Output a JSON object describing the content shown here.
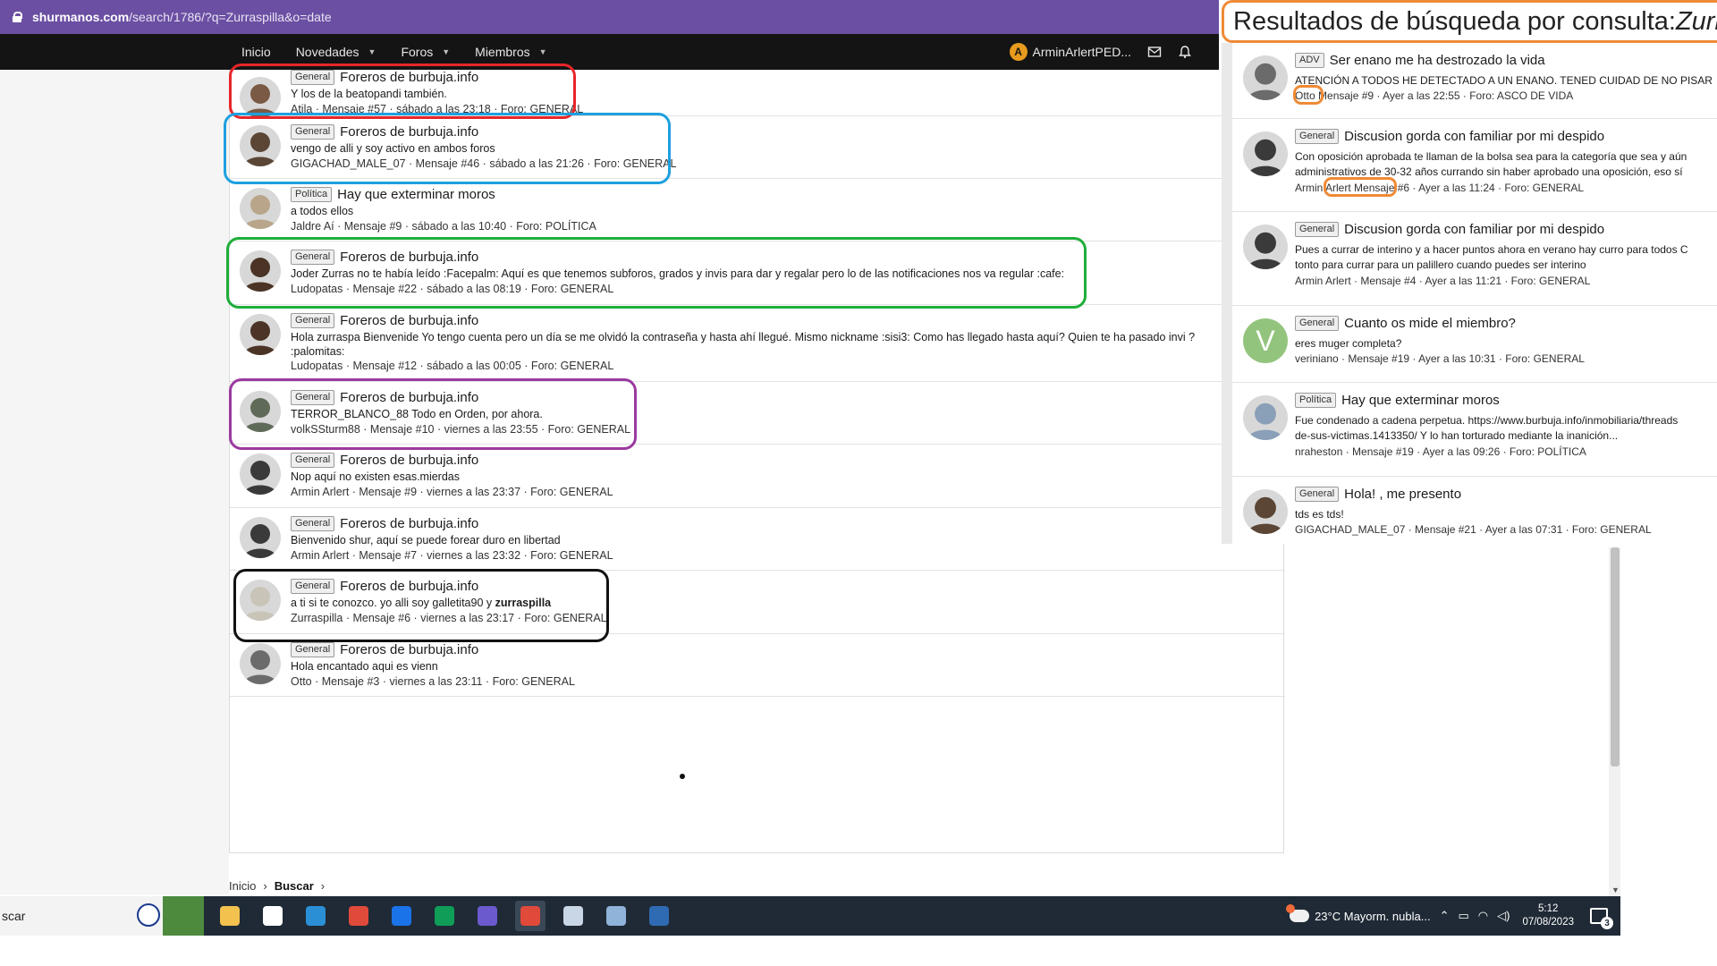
{
  "browser": {
    "url_host": "shurmanos.com",
    "url_path": "/search/1786/?q=Zurraspilla&o=date"
  },
  "nav": {
    "items": [
      {
        "label": "Inicio",
        "has_caret": false
      },
      {
        "label": "Novedades",
        "has_caret": true
      },
      {
        "label": "Foros",
        "has_caret": true
      },
      {
        "label": "Miembros",
        "has_caret": true
      }
    ],
    "user_initial": "A",
    "user_name": "ArminArlertPED..."
  },
  "results": [
    {
      "badge": "General",
      "title": "Foreros de burbuja.info",
      "snippet": "Y los de la beatopandi también.",
      "meta": "Atila · Mensaje #57 · sábado a las 23:18 · Foro: GENERAL",
      "avatar_color": "#7a5a44",
      "highlight": "#e8262a"
    },
    {
      "badge": "General",
      "title": "Foreros de burbuja.info",
      "snippet": "vengo de alli y soy activo en ambos foros",
      "meta": "GIGACHAD_MALE_07 · Mensaje #46 · sábado a las 21:26 · Foro: GENERAL",
      "avatar_color": "#5b4636",
      "highlight": "#1ea0e0"
    },
    {
      "badge": "Política",
      "title": "Hay que exterminar moros",
      "snippet": "a todos ellos",
      "meta": "Jaldre Aí · Mensaje #9 · sábado a las 10:40 · Foro: POLÍTICA",
      "avatar_color": "#b9a68a",
      "highlight": ""
    },
    {
      "badge": "General",
      "title": "Foreros de burbuja.info",
      "snippet": "Joder Zurras no te había leído :Facepalm: Aquí es que tenemos subforos, grados y invis para dar y regalar pero lo de las notificaciones nos va regular :cafe:",
      "meta": "Ludopatas · Mensaje #22 · sábado a las 08:19 · Foro: GENERAL",
      "avatar_color": "#4b3425",
      "highlight": "#1fae3a"
    },
    {
      "badge": "General",
      "title": "Foreros de burbuja.info",
      "snippet": "Hola zurraspa Bienvenide Yo tengo cuenta pero un día se me olvidó la contraseña y hasta ahí llegué. Mismo nickname :sisi3: Como has llegado hasta aquí? Quien te ha pasado invi ?",
      "snippet2": ":palomitas:",
      "meta": "Ludopatas · Mensaje #12 · sábado a las 00:05 · Foro: GENERAL",
      "avatar_color": "#4b3425",
      "highlight": ""
    },
    {
      "badge": "General",
      "title": "Foreros de burbuja.info",
      "snippet": "TERROR_BLANCO_88 Todo en Orden, por ahora.",
      "meta": "volkSSturm88 · Mensaje #10 · viernes a las 23:55 · Foro: GENERAL",
      "avatar_color": "#5f6a58",
      "highlight": "#9b3aa0"
    },
    {
      "badge": "General",
      "title": "Foreros de burbuja.info",
      "snippet": "Nop aquí no existen esas.mierdas",
      "meta": "Armin Arlert · Mensaje #9 · viernes a las 23:37 · Foro: GENERAL",
      "avatar_color": "#3a3a3a",
      "highlight": ""
    },
    {
      "badge": "General",
      "title": "Foreros de burbuja.info",
      "snippet": "Bienvenido shur, aquí se puede forear duro en libertad",
      "meta": "Armin Arlert · Mensaje #7 · viernes a las 23:32 · Foro: GENERAL",
      "avatar_color": "#3a3a3a",
      "highlight": ""
    },
    {
      "badge": "General",
      "title": "Foreros de burbuja.info",
      "snippet_pre": "a ti si te conozco. yo alli soy galletita90 y ",
      "snippet_bold": "zurraspilla",
      "meta": "Zurraspilla · Mensaje #6 · viernes a las 23:17 · Foro: GENERAL",
      "avatar_color": "#c9c4b8",
      "highlight": "#111111"
    },
    {
      "badge": "General",
      "title": "Foreros de burbuja.info",
      "snippet": "Hola encantado aqui es vienn",
      "meta": "Otto · Mensaje #3 · viernes a las 23:11 · Foro: GENERAL",
      "avatar_color": "#6b6b6b",
      "highlight": ""
    }
  ],
  "breadcrumb": {
    "home": "Inicio",
    "current": "Buscar"
  },
  "right_panel": {
    "header_prefix": "Resultados de búsqueda por consulta: ",
    "header_query": "Zurra",
    "items": [
      {
        "badge": "ADV",
        "title": "Ser enano me ha destrozado la vida",
        "snippet": "ATENCIÓN A TODOS HE DETECTADO A UN ENANO. TENED CUIDAD DE NO PISAR",
        "user": "Otto",
        "meta": " Mensaje #9 · Ayer a las 22:55 · Foro: ASCO DE VIDA",
        "avatar_color": "#6b6b6b"
      },
      {
        "badge": "General",
        "title": "Discusion gorda con familiar por mi despido",
        "snippet": "Con oposición aprobada te llaman de la bolsa sea para la categoría que sea y aún",
        "snippet2": "administrativos de 30-32 años currando sin haber aprobado una oposición, eso sí",
        "user": "Armin Arlert",
        "meta": " Mensaje #6 · Ayer a las 11:24 · Foro: GENERAL",
        "avatar_color": "#3a3a3a"
      },
      {
        "badge": "General",
        "title": "Discusion gorda con familiar por mi despido",
        "snippet": "Pues a currar de interino y a hacer puntos ahora en verano hay curro para todos C",
        "snippet2": "tonto para currar para un palillero cuando puedes ser interino",
        "meta": "Armin Arlert · Mensaje #4 · Ayer a las 11:21 · Foro: GENERAL",
        "avatar_color": "#3a3a3a"
      },
      {
        "badge": "General",
        "title": "Cuanto os mide el miembro?",
        "snippet": "eres muger completa?",
        "meta": "veriniano · Mensaje #19 · Ayer a las 10:31 · Foro: GENERAL",
        "avatar_letter": "V"
      },
      {
        "badge": "Política",
        "title": "Hay que exterminar moros",
        "snippet": "Fue condenado a cadena perpetua. https://www.burbuja.info/inmobiliaria/threads",
        "snippet2": "de-sus-victimas.1413350/ Y lo han torturado mediante la inanición...",
        "meta": "nraheston · Mensaje #19 · Ayer a las 09:26 · Foro: POLÍTICA",
        "avatar_color": "#8aa0b8"
      },
      {
        "badge": "General",
        "title": "Hola! , me presento",
        "snippet": "tds es tds!",
        "meta": "GIGACHAD_MALE_07 · Mensaje #21 · Ayer a las 07:31 · Foro: GENERAL",
        "avatar_color": "#5b4636"
      }
    ]
  },
  "taskbar": {
    "search_text": "scar",
    "weather": "23°C  Mayorm. nubla...",
    "time": "5:12",
    "date": "07/08/2023",
    "notifications": "3",
    "app_colors": [
      "#f2c14e",
      "#ffffff",
      "#2b8fd6",
      "#e04a3a",
      "#1a73e8",
      "#0f9d58",
      "#6a5acd",
      "#e04a3a",
      "#c8d6e5",
      "#8fb3d9",
      "#2f6bb3"
    ]
  },
  "colors": {
    "address_bar": "#6b4fa3",
    "nav_bar": "#141414",
    "right_panel_accent": "#ef8a35"
  }
}
